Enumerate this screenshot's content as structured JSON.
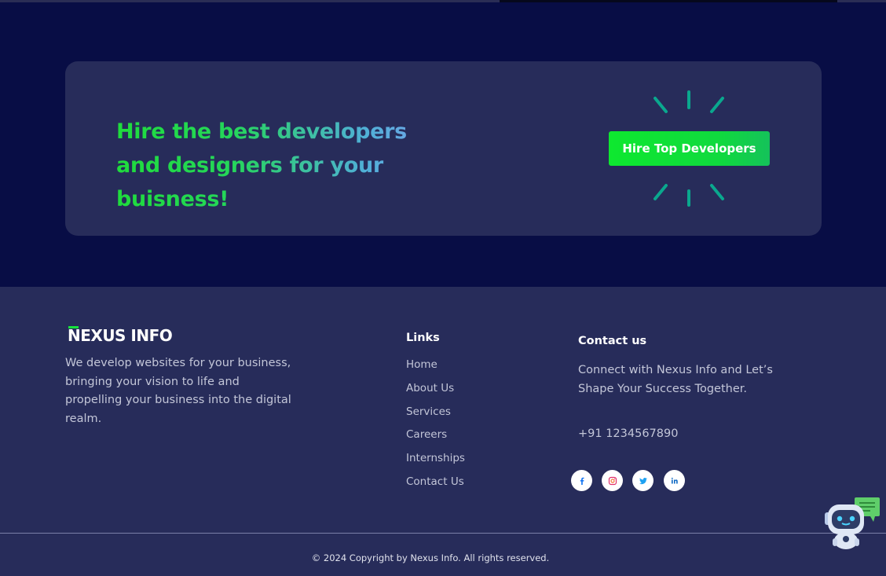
{
  "cta": {
    "heading": "Hire the best developers and designers for your buisness!",
    "button_label": "Hire Top Developers"
  },
  "footer": {
    "logo_text": "NEXUS INFO",
    "about": "We develop websites for your business, bringing your vision to life and propelling your business into the digital realm.",
    "links_title": "Links",
    "links": [
      {
        "label": "Home"
      },
      {
        "label": "About Us"
      },
      {
        "label": "Services"
      },
      {
        "label": "Careers"
      },
      {
        "label": "Internships"
      },
      {
        "label": "Contact Us"
      }
    ],
    "contact_title": "Contact us",
    "contact_text": "Connect with Nexus Info and Let’s Shape Your Success Together.",
    "phone": "+91 1234567890",
    "social": [
      {
        "icon": "facebook-icon",
        "color": "#1877f2"
      },
      {
        "icon": "instagram-icon",
        "color": "#e1306c"
      },
      {
        "icon": "twitter-icon",
        "color": "#1da1f2"
      },
      {
        "icon": "linkedin-icon",
        "color": "#0a66c2"
      }
    ],
    "copyright": "© 2024 Copyright by Nexus Info. All rights reserved."
  },
  "colors": {
    "background": "#0a0f45",
    "card": "#272c5a",
    "accent_green": "#16e23c"
  }
}
